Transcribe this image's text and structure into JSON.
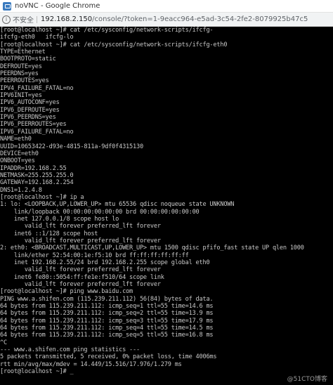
{
  "window": {
    "title": "noVNC - Google Chrome"
  },
  "address_bar": {
    "security_label": "不安全",
    "url_host": "192.168.2.150",
    "url_rest": "/console/?token=1-9eacc964-e5ad-3c54-2fe2-8079925b47c5"
  },
  "terminal": {
    "lines": [
      "[root@localhost ~]# cat /etc/sysconfig/network-scripts/ifcfg-",
      "ifcfg-eth0   ifcfg-lo",
      "[root@localhost ~]# cat /etc/sysconfig/network-scripts/ifcfg-eth0",
      "TYPE=Ethernet",
      "BOOTPROTO=static",
      "DEFROUTE=yes",
      "PEERDNS=yes",
      "PEERROUTES=yes",
      "IPV4_FAILURE_FATAL=no",
      "IPV6INIT=yes",
      "IPV6_AUTOCONF=yes",
      "IPV6_DEFROUTE=yes",
      "IPV6_PEERDNS=yes",
      "IPV6_PEERROUTES=yes",
      "IPV6_FAILURE_FATAL=no",
      "NAME=eth0",
      "UUID=10653422-d93e-4815-811a-9df0f4315130",
      "DEVICE=eth0",
      "ONBOOT=yes",
      "IPADDR=192.168.2.55",
      "NETMASK=255.255.255.0",
      "GATEWAY=192.168.2.254",
      "DNS1=1.2.4.8",
      "[root@localhost ~]# ip a",
      "1: lo: <LOOPBACK,UP,LOWER_UP> mtu 65536 qdisc noqueue state UNKNOWN",
      "    link/loopback 00:00:00:00:00:00 brd 00:00:00:00:00:00",
      "    inet 127.0.0.1/8 scope host lo",
      "       valid_lft forever preferred_lft forever",
      "    inet6 ::1/128 scope host",
      "       valid_lft forever preferred_lft forever",
      "2: eth0: <BROADCAST,MULTICAST,UP,LOWER_UP> mtu 1500 qdisc pfifo_fast state UP qlen 1000",
      "    link/ether 52:54:00:1e:f5:10 brd ff:ff:ff:ff:ff:ff",
      "    inet 192.168.2.55/24 brd 192.168.2.255 scope global eth0",
      "       valid_lft forever preferred_lft forever",
      "    inet6 fe80::5054:ff:fe1e:f510/64 scope link",
      "       valid_lft forever preferred_lft forever",
      "[root@localhost ~]# ping www.baidu.com",
      "PING www.a.shifen.com (115.239.211.112) 56(84) bytes of data.",
      "64 bytes from 115.239.211.112: icmp_seq=1 ttl=55 time=14.6 ms",
      "64 bytes from 115.239.211.112: icmp_seq=2 ttl=55 time=13.9 ms",
      "64 bytes from 115.239.211.112: icmp_seq=3 ttl=55 time=17.9 ms",
      "64 bytes from 115.239.211.112: icmp_seq=4 ttl=55 time=14.5 ms",
      "64 bytes from 115.239.211.112: icmp_seq=5 ttl=55 time=16.8 ms",
      "^C",
      "--- www.a.shifen.com ping statistics ---",
      "5 packets transmitted, 5 received, 0% packet loss, time 4006ms",
      "rtt min/avg/max/mdev = 14.449/15.516/17.976/1.279 ms",
      "[root@localhost ~]# _"
    ]
  },
  "watermark": "@51CTO博客"
}
